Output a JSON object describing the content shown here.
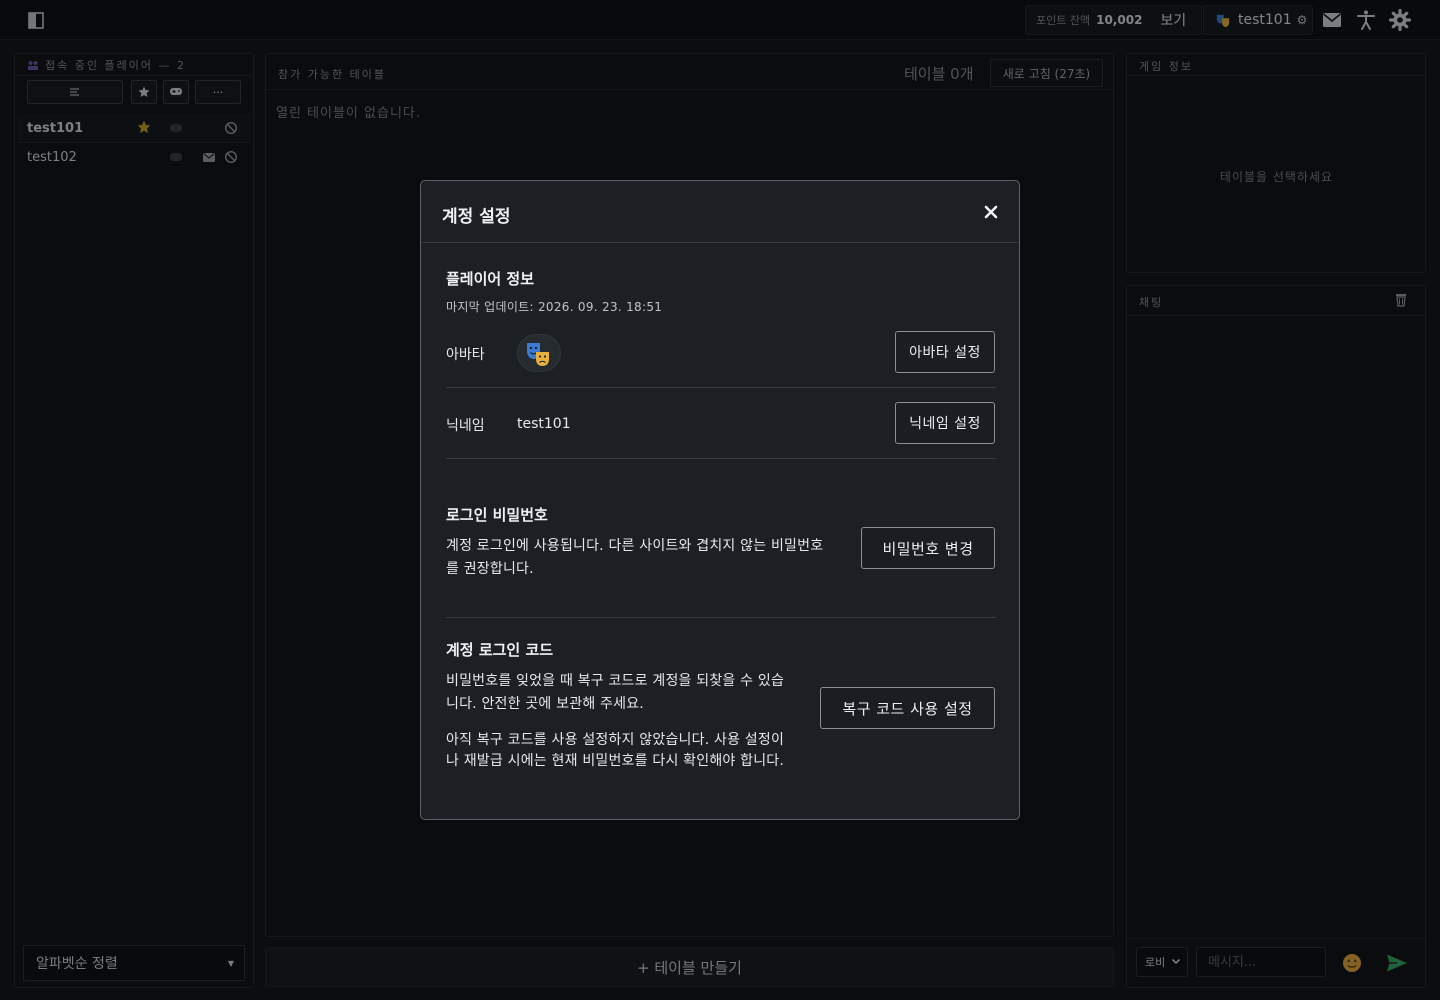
{
  "topbar": {
    "points_label": "포인트 잔액",
    "points_value": "10,002",
    "view_label": "보기",
    "username": "test101"
  },
  "left_panel": {
    "title": "접속 중인 플레이어 — 2",
    "more_label": "···",
    "players": [
      {
        "name": "test101"
      },
      {
        "name": "test102"
      }
    ],
    "sort_label": "알파벳순 정렬"
  },
  "center_panel": {
    "title": "참가 가능한 테이블",
    "count_label": "테이블 0개",
    "refresh_label": "새로 고침 (27초)",
    "empty_message": "열린 테이블이 없습니다.",
    "create_button": "+ 테이블 만들기"
  },
  "game_info": {
    "title": "게임 정보",
    "hint": "테이블을 선택하세요"
  },
  "chat": {
    "title": "채팅",
    "channel": "로비",
    "placeholder": "메시지..."
  },
  "modal": {
    "title": "계정 설정",
    "player_info_title": "플레이어 정보",
    "last_updated": "마지막 업데이트: 2026. 09. 23. 18:51",
    "avatar_label": "아바타",
    "avatar_button": "아바타 설정",
    "nickname_label": "닉네임",
    "nickname_value": "test101",
    "nickname_button": "닉네임 설정",
    "password_title": "로그인 비밀번호",
    "password_desc_line1": "계정 로그인에 사용됩니다. 다른 사이트와 겹치지 않는 비밀번호",
    "password_desc_line2": "를 권장합니다.",
    "password_button": "비밀번호 변경",
    "code_title": "계정 로그인 코드",
    "code_desc_line1": "비밀번호를 잊었을 때 복구 코드로 계정을 되찾을 수 있습",
    "code_desc_line2": "니다. 안전한 곳에 보관해 주세요.",
    "code_note_line1": "아직 복구 코드를 사용 설정하지 않았습니다. 사용 설정이",
    "code_note_line2": "나 재발급 시에는 현재 비밀번호를 다시 확인해야 합니다.",
    "code_button": "복구 코드 사용 설정"
  },
  "colors": {
    "accent_green": "#3aa567",
    "star_gold": "#c8a22c"
  }
}
